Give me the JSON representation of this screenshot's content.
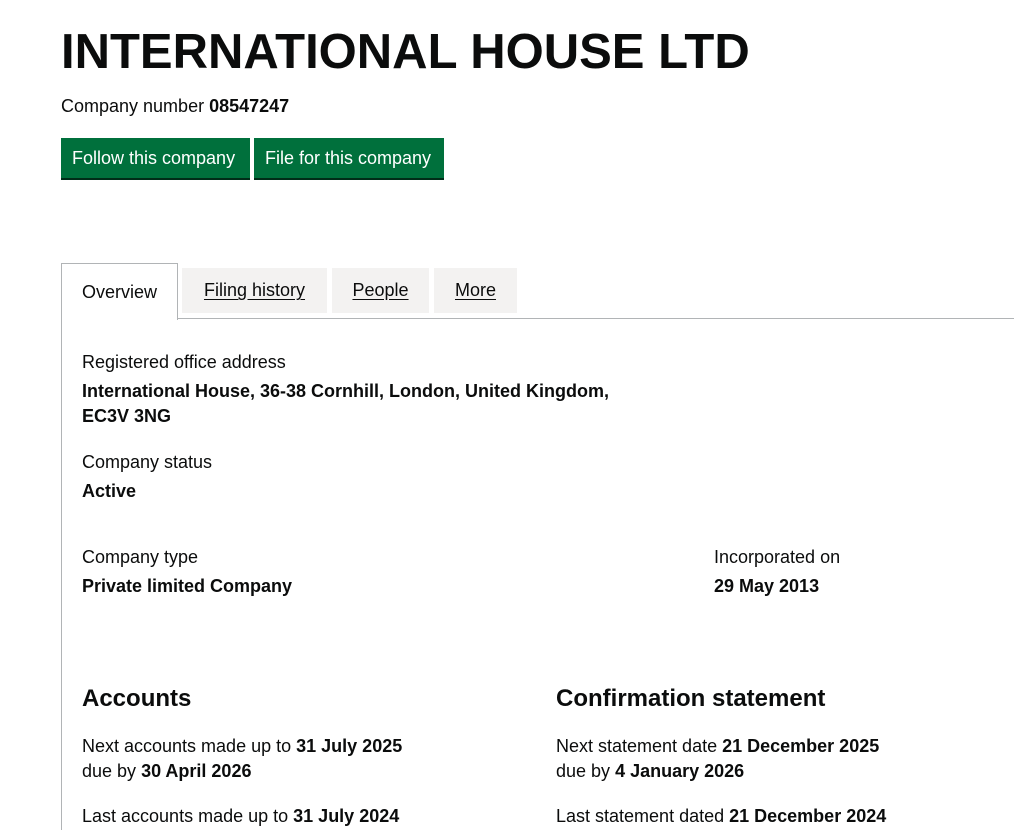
{
  "company": {
    "name": "INTERNATIONAL HOUSE LTD",
    "number_label": "Company number",
    "number": "08547247"
  },
  "actions": {
    "follow_label": "Follow this company",
    "file_label": "File for this company"
  },
  "tabs": [
    {
      "label": "Overview",
      "active": true
    },
    {
      "label": "Filing history",
      "active": false
    },
    {
      "label": "People",
      "active": false
    },
    {
      "label": "More",
      "active": false
    }
  ],
  "overview": {
    "registered_office_label": "Registered office address",
    "registered_office_line1": "International House, 36-38 Cornhill, London, United Kingdom,",
    "registered_office_line2": "EC3V 3NG",
    "status_label": "Company status",
    "status_value": "Active",
    "type_label": "Company type",
    "type_value": "Private limited Company",
    "incorporated_label": "Incorporated on",
    "incorporated_value": "29 May 2013"
  },
  "accounts": {
    "heading": "Accounts",
    "next_made_up_prefix": "Next accounts made up to",
    "next_made_up_date": "31 July 2025",
    "due_by_prefix": "due by",
    "due_by_date": "30 April 2026",
    "last_made_up_prefix": "Last accounts made up to",
    "last_made_up_date": "31 July 2024"
  },
  "confirmation": {
    "heading": "Confirmation statement",
    "next_statement_prefix": "Next statement date",
    "next_statement_date": "21 December 2025",
    "due_by_prefix": "due by",
    "due_by_date": "4 January 2026",
    "last_statement_prefix": "Last statement dated",
    "last_statement_date": "21 December 2024"
  }
}
